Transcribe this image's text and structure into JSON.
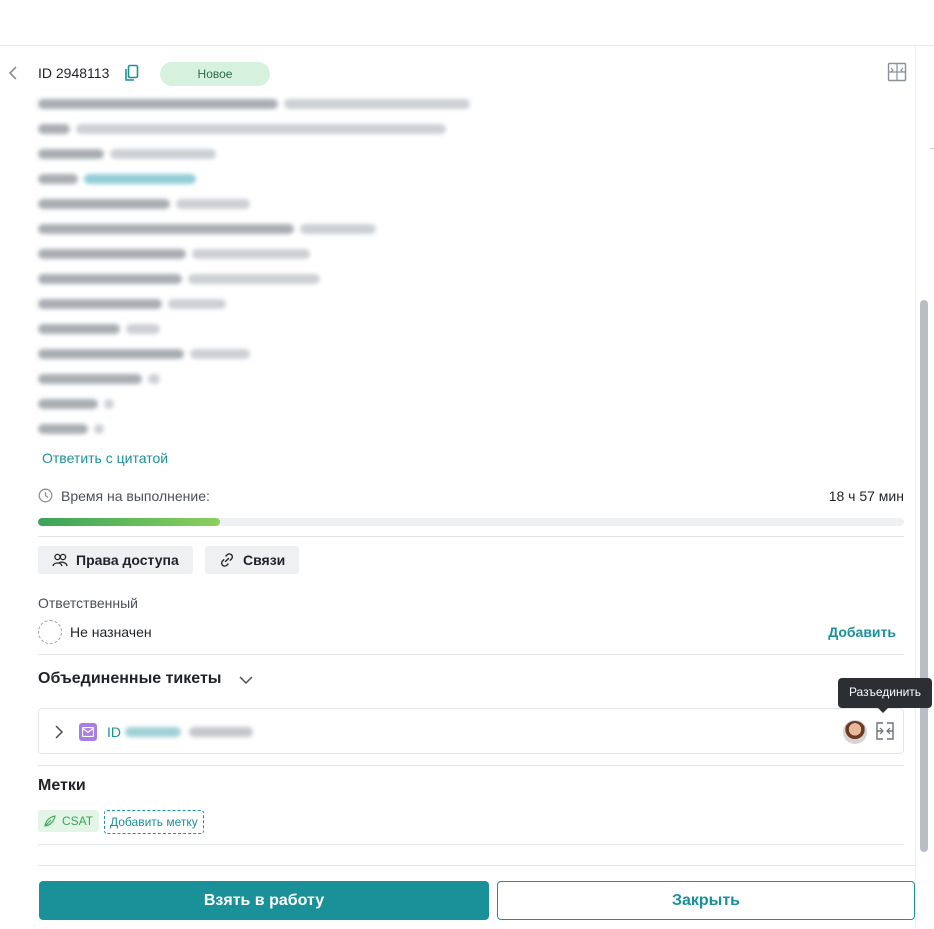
{
  "header": {
    "ticket_id": "ID 2948113",
    "status": "Новое"
  },
  "details": {
    "reply_with_quote": "Ответить с цитатой"
  },
  "sla": {
    "label": "Время на выполнение:",
    "value": "18 ч 57 мин",
    "progress_fraction": 0.21
  },
  "actions": {
    "access_rights": "Права доступа",
    "links": "Связи"
  },
  "responsible": {
    "title": "Ответственный",
    "value": "Не назначен",
    "add_label": "Добавить"
  },
  "merged": {
    "title": "Объединенные тикеты",
    "tooltip": "Разъединить",
    "items": [
      {
        "id_prefix": "ID"
      }
    ]
  },
  "tags": {
    "title": "Метки",
    "items": [
      "CSAT"
    ],
    "add_label": "Добавить метку"
  },
  "footer": {
    "take_label": "Взять в работу",
    "close_label": "Закрыть"
  },
  "colors": {
    "accent": "#1a9199",
    "status_bg": "#d6f2df",
    "progress": "#3aa35a",
    "tag_bg": "#e3f5e7",
    "mail_icon": "#a87ee0",
    "tooltip_bg": "#2b2f33"
  }
}
